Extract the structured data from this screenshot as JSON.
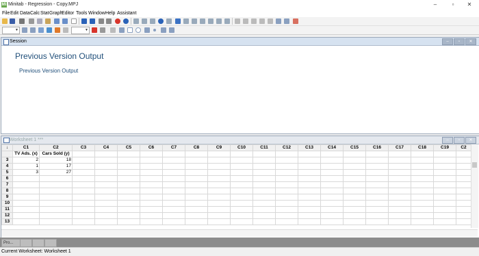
{
  "window": {
    "title": "Minitab - Regression - Copy.MPJ",
    "app_icon": "Mi",
    "controls": [
      "–",
      "▫",
      "✕"
    ]
  },
  "menu": [
    "File",
    "Edit",
    "Data",
    "Calc",
    "Stat",
    "Graph",
    "Editor",
    "Tools",
    "Window",
    "Help",
    "Assistant"
  ],
  "toolbar_icons": [
    "open-icon",
    "save-icon",
    "print-icon",
    "cut-icon",
    "copy-icon",
    "paste-icon",
    "undo-icon",
    "redo-icon",
    "blank-icon",
    "up-arrow-icon",
    "down-arrow-icon",
    "binoculars-icon",
    "find-icon",
    "cancel-icon",
    "help-icon",
    "show-sheet-icon",
    "show-graph-icon",
    "graph-brush-icon",
    "info-icon",
    "project-icon",
    "session-icon",
    "worksheet-icon",
    "graph-folder-icon",
    "report-icon",
    "formula-icon",
    "column-icon",
    "row-icon",
    "insert-icon",
    "brush-icon",
    "delete-icon"
  ],
  "session": {
    "title": "Session",
    "heading": "Previous Version Output",
    "subheading": "Previous Version Output"
  },
  "worksheet": {
    "title": "Worksheet 1 ***",
    "corner": "↓",
    "columns": [
      "C1",
      "C2",
      "C3",
      "C4",
      "C5",
      "C6",
      "C7",
      "C8",
      "C9",
      "C10",
      "C11",
      "C12",
      "C13",
      "C14",
      "C15",
      "C16",
      "C17",
      "C18",
      "C19",
      "C2"
    ],
    "names": [
      "TV Ads. (x)",
      "Cars Sold (y)"
    ],
    "rows": [
      {
        "id": "3",
        "c1": "2",
        "c2": "18"
      },
      {
        "id": "4",
        "c1": "1",
        "c2": "17"
      },
      {
        "id": "5",
        "c1": "3",
        "c2": "27"
      },
      {
        "id": "6",
        "c1": "",
        "c2": ""
      },
      {
        "id": "7",
        "c1": "",
        "c2": ""
      },
      {
        "id": "8",
        "c1": "",
        "c2": ""
      },
      {
        "id": "9",
        "c1": "",
        "c2": ""
      },
      {
        "id": "10",
        "c1": "",
        "c2": ""
      },
      {
        "id": "11",
        "c1": "",
        "c2": ""
      },
      {
        "id": "12",
        "c1": "",
        "c2": ""
      },
      {
        "id": "13",
        "c1": "",
        "c2": ""
      }
    ]
  },
  "tabs": [
    "Pro...",
    "",
    "",
    ""
  ],
  "status": "Current Worksheet: Worksheet 1",
  "colors": {
    "accent": "#1f4e79",
    "header": "#d6e2f0"
  }
}
